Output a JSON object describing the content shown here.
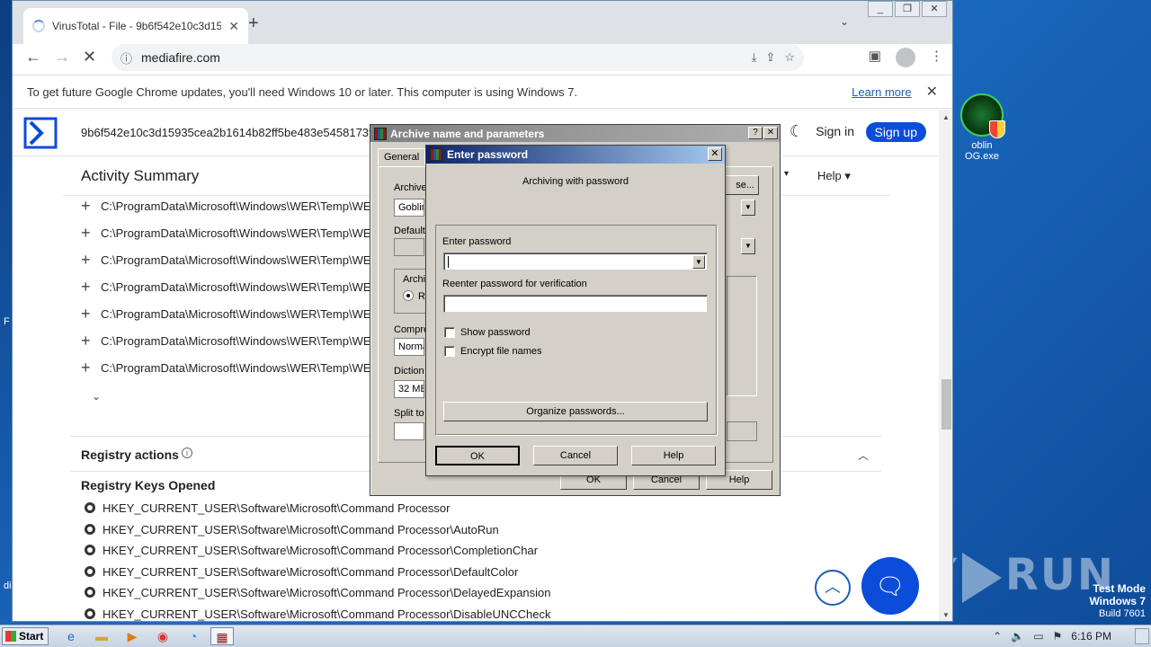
{
  "browser": {
    "tab_title": "VirusTotal - File - 9b6f542e10c3d159",
    "url": "mediafire.com",
    "infobar_message": "To get future Google Chrome updates, you'll need Windows 10 or later. This computer is using Windows 7.",
    "infobar_link": "Learn more"
  },
  "virustotal": {
    "hash": "9b6f542e10c3d15935cea2b1614b82ff5be483e5458173f",
    "sign_in": "Sign in",
    "sign_up": "Sign up",
    "activity_title": "Activity Summary",
    "help_menu": "Help",
    "paths": [
      "C:\\ProgramData\\Microsoft\\Windows\\WER\\Temp\\WE",
      "C:\\ProgramData\\Microsoft\\Windows\\WER\\Temp\\WE",
      "C:\\ProgramData\\Microsoft\\Windows\\WER\\Temp\\WE",
      "C:\\ProgramData\\Microsoft\\Windows\\WER\\Temp\\WE",
      "C:\\ProgramData\\Microsoft\\Windows\\WER\\Temp\\WE",
      "C:\\ProgramData\\Microsoft\\Windows\\WER\\Temp\\WE",
      "C:\\ProgramData\\Microsoft\\Windows\\WER\\Temp\\WE"
    ],
    "registry_title": "Registry actions",
    "registry_keys_title": "Registry Keys Opened",
    "registry_keys": [
      "HKEY_CURRENT_USER\\Software\\Microsoft\\Command Processor",
      "HKEY_CURRENT_USER\\Software\\Microsoft\\Command Processor\\AutoRun",
      "HKEY_CURRENT_USER\\Software\\Microsoft\\Command Processor\\CompletionChar",
      "HKEY_CURRENT_USER\\Software\\Microsoft\\Command Processor\\DefaultColor",
      "HKEY_CURRENT_USER\\Software\\Microsoft\\Command Processor\\DelayedExpansion",
      "HKEY_CURRENT_USER\\Software\\Microsoft\\Command Processor\\DisableUNCCheck"
    ]
  },
  "archive_dialog": {
    "title": "Archive name and parameters",
    "tab_general": "General",
    "label_archive": "Archive",
    "archive_value": "Goblin",
    "label_default": "Default",
    "label_archiving": "Archi",
    "radio_label": "R",
    "label_compression": "Compre",
    "compression_value": "Norma",
    "label_dictionary": "Diction",
    "dictionary_value": "32 MB",
    "label_split": "Split to",
    "browse_label": "se...",
    "ok": "OK",
    "cancel": "Cancel",
    "help": "Help"
  },
  "password_dialog": {
    "title": "Enter password",
    "subtitle": "Archiving with password",
    "enter_label": "Enter password",
    "reenter_label": "Reenter password for verification",
    "show_password": "Show password",
    "encrypt_names": "Encrypt file names",
    "organize": "Organize passwords...",
    "ok": "OK",
    "cancel": "Cancel",
    "help": "Help"
  },
  "desktop": {
    "icon_label": "oblin OG.exe",
    "watermark": "ANY RUN",
    "test_mode": "Test Mode",
    "os_name": "Windows 7",
    "build": "Build 7601"
  },
  "taskbar": {
    "start": "Start",
    "clock": "6:16 PM"
  }
}
